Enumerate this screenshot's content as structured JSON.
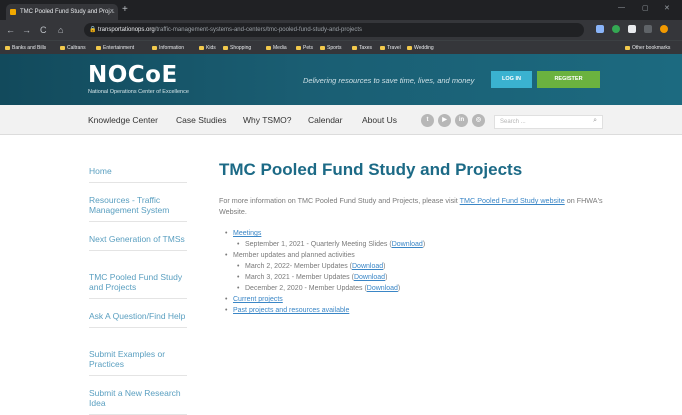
{
  "browser": {
    "tab_title": "TMC Pooled Fund Study and Proj...",
    "tab_close": "×",
    "new_tab": "+",
    "nav": {
      "back": "←",
      "forward": "→",
      "reload": "C",
      "home": "⌂"
    },
    "url_host": "transportationops.org",
    "url_path": "/traffic-management-systems-and-centers/tmc-pooled-fund-study-and-projects",
    "bookmarks": [
      "Banks and Bills",
      "Caltrans",
      "Entertainment",
      "Information",
      "Kids",
      "Shopping",
      "Media",
      "Pets",
      "Sports",
      "Taxes",
      "Travel",
      "Wedding"
    ],
    "other_bookmarks": "Other bookmarks"
  },
  "header": {
    "logo_main": "NOCoE",
    "logo_sub": "National Operations Center of Excellence",
    "tagline": "Delivering resources to save time, lives, and money",
    "login_label": "LOG IN",
    "register_label": "REGISTER"
  },
  "nav": {
    "items": [
      "Knowledge Center",
      "Case Studies",
      "Why TSMO?",
      "Calendar",
      "About Us"
    ],
    "search_placeholder": "Search ..."
  },
  "sidebar": {
    "items": [
      "Home",
      "Resources - Traffic Management System",
      "Next Generation of TMSs",
      "TMC Pooled Fund Study and Projects",
      "Ask A Question/Find Help",
      "Submit Examples or Practices",
      "Submit a New Research Idea"
    ]
  },
  "main": {
    "title": "TMC Pooled Fund Study and Projects",
    "intro_before": "For more information on TMC Pooled Fund Study and Projects, please visit ",
    "intro_link": "TMC Pooled Fund Study website",
    "intro_after": " on FHWA's Website.",
    "meetings": "Meetings",
    "meeting_1": "September 1, 2021 - Quarterly Meeting Slides (",
    "download": "Download",
    "close_paren": ")",
    "member_updates": "Member updates and planned activities",
    "update_1": "March 2, 2022- Member Updates (",
    "update_2": "March 3, 2021 - Member Updates (",
    "update_3": "December 2, 2020 - Member Updates (",
    "current_projects": "Current projects",
    "past_projects": "Past projects and resources available"
  }
}
